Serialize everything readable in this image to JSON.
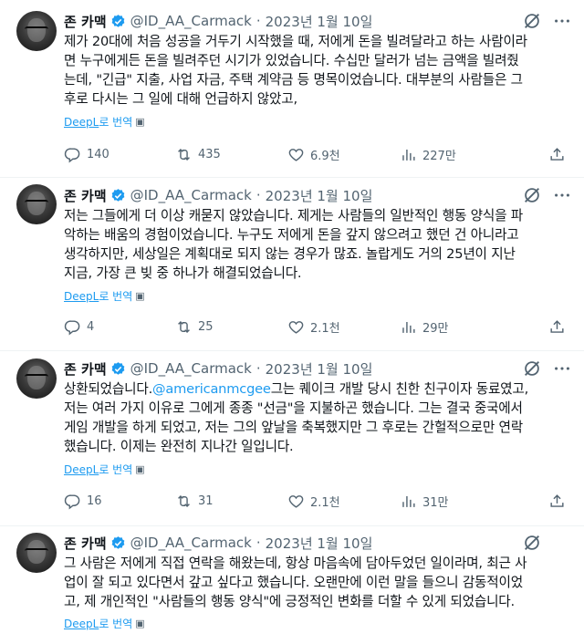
{
  "tweets": [
    {
      "name": "존 카맥",
      "handle": "@ID_AA_Carmack",
      "dot": "·",
      "date": "2023년 1월 10일",
      "lines": [
        "제가 20대에 처음 성공을 거두기 시작했을 때, 저에게 돈을 빌려달라고 하는 사람이라",
        "면 누구에게든 돈을 빌려주던 시기가 있었습니다. 수십만 달러가 넘는 금액을 빌려줬",
        "는데, \"긴급\" 지출, 사업 자금, 주택 계약금 등 명목이었습니다. 대부분의 사람들은 그",
        "후로 다시는 그 일에 대해 언급하지 않았고,"
      ],
      "translate": {
        "brand": "DeepL",
        "text": "로 번역"
      },
      "stats": {
        "replies": "140",
        "retweets": "435",
        "likes": "6.9천",
        "views": "227만"
      }
    },
    {
      "name": "존 카맥",
      "handle": "@ID_AA_Carmack",
      "dot": "·",
      "date": "2023년 1월 10일",
      "lines": [
        "저는 그들에게 더 이상 캐묻지 않았습니다. 제게는 사람들의 일반적인 행동 양식을 파",
        "악하는 배움의 경험이었습니다. 누구도 저에게 돈을 갚지 않으려고 했던 건 아니라고",
        "생각하지만, 세상일은 계획대로 되지 않는 경우가 많죠. 놀랍게도 거의 25년이 지난",
        "지금, 가장 큰 빚 중 하나가 해결되었습니다."
      ],
      "translate": {
        "brand": "DeepL",
        "text": "로 번역"
      },
      "stats": {
        "replies": "4",
        "retweets": "25",
        "likes": "2.1천",
        "views": "29만"
      }
    },
    {
      "name": "존 카맥",
      "handle": "@ID_AA_Carmack",
      "dot": "·",
      "date": "2023년 1월 10일",
      "line1_prefix": "상환되었습니다.",
      "mention": "@americanmcgee",
      "line1_suffix": "그는 퀘이크 개발 당시 친한 친구이자 동료였고,",
      "lines_rest": [
        "저는 여러 가지 이유로 그에게 종종 \"선금\"을 지불하곤 했습니다. 그는 결국 중국에서",
        "게임 개발을 하게 되었고, 저는 그의 앞날을 축복했지만 그 후로는 간헐적으로만 연락",
        "했습니다. 이제는 완전히 지나간 일입니다."
      ],
      "translate": {
        "brand": "DeepL",
        "text": "로 번역"
      },
      "stats": {
        "replies": "16",
        "retweets": "31",
        "likes": "2.1천",
        "views": "31만"
      }
    },
    {
      "name": "존 카맥",
      "handle": "@ID_AA_Carmack",
      "dot": "·",
      "date": "2023년 1월 10일",
      "lines": [
        "그 사람은 저에게 직접 연락을 해왔는데, 항상 마음속에 담아두었던 일이라며, 최근 사",
        "업이 잘 되고 있다면서 갚고 싶다고 했습니다. 오랜만에 이런 말을 들으니 감동적이었",
        "고, 제 개인적인 \"사람들의 행동 양식\"에 긍정적인 변화를 더할 수 있게 되었습니다."
      ],
      "translate": {
        "brand": "DeepL",
        "text": "로 번역"
      }
    }
  ],
  "colors": {
    "accent": "#1d9bf0",
    "muted": "#536471",
    "text": "#0f1419"
  },
  "icons": [
    "verified-badge-icon",
    "grok-icon",
    "more-icon",
    "reply-icon",
    "retweet-icon",
    "like-icon",
    "views-icon",
    "share-icon"
  ]
}
